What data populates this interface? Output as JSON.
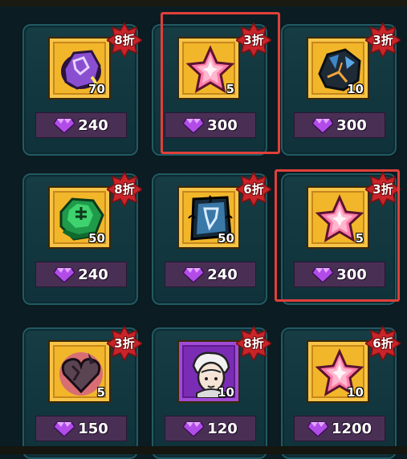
{
  "colors": {
    "highlight": "#e0403a",
    "badge": "#c8242a",
    "frame": "#f2b62a",
    "price_bg": "#4a2f55"
  },
  "currency_icon": "purple-gem-icon",
  "items": [
    {
      "name": "purple-rune-stone",
      "icon": "rune-stone-icon",
      "qty": "70",
      "discount": "8折",
      "price": "240"
    },
    {
      "name": "pink-star",
      "icon": "star-crystal-icon",
      "qty": "5",
      "discount": "3折",
      "price": "300"
    },
    {
      "name": "dark-ore",
      "icon": "ore-icon",
      "qty": "10",
      "discount": "3折",
      "price": "300"
    },
    {
      "name": "green-emerald",
      "icon": "emerald-icon",
      "qty": "50",
      "discount": "8折",
      "price": "240"
    },
    {
      "name": "rune-banner",
      "icon": "rune-banner-icon",
      "qty": "50",
      "discount": "6折",
      "price": "240"
    },
    {
      "name": "pink-star-2",
      "icon": "star-crystal-icon",
      "qty": "5",
      "discount": "3折",
      "price": "300"
    },
    {
      "name": "cursed-heart",
      "icon": "cursed-heart-icon",
      "qty": "5",
      "discount": "3折",
      "price": "150"
    },
    {
      "name": "hero-portrait",
      "icon": "hero-portrait-icon",
      "qty": "10",
      "discount": "8折",
      "price": "120"
    },
    {
      "name": "pink-star-3",
      "icon": "star-crystal-icon",
      "qty": "10",
      "discount": "6折",
      "price": "1200"
    }
  ]
}
